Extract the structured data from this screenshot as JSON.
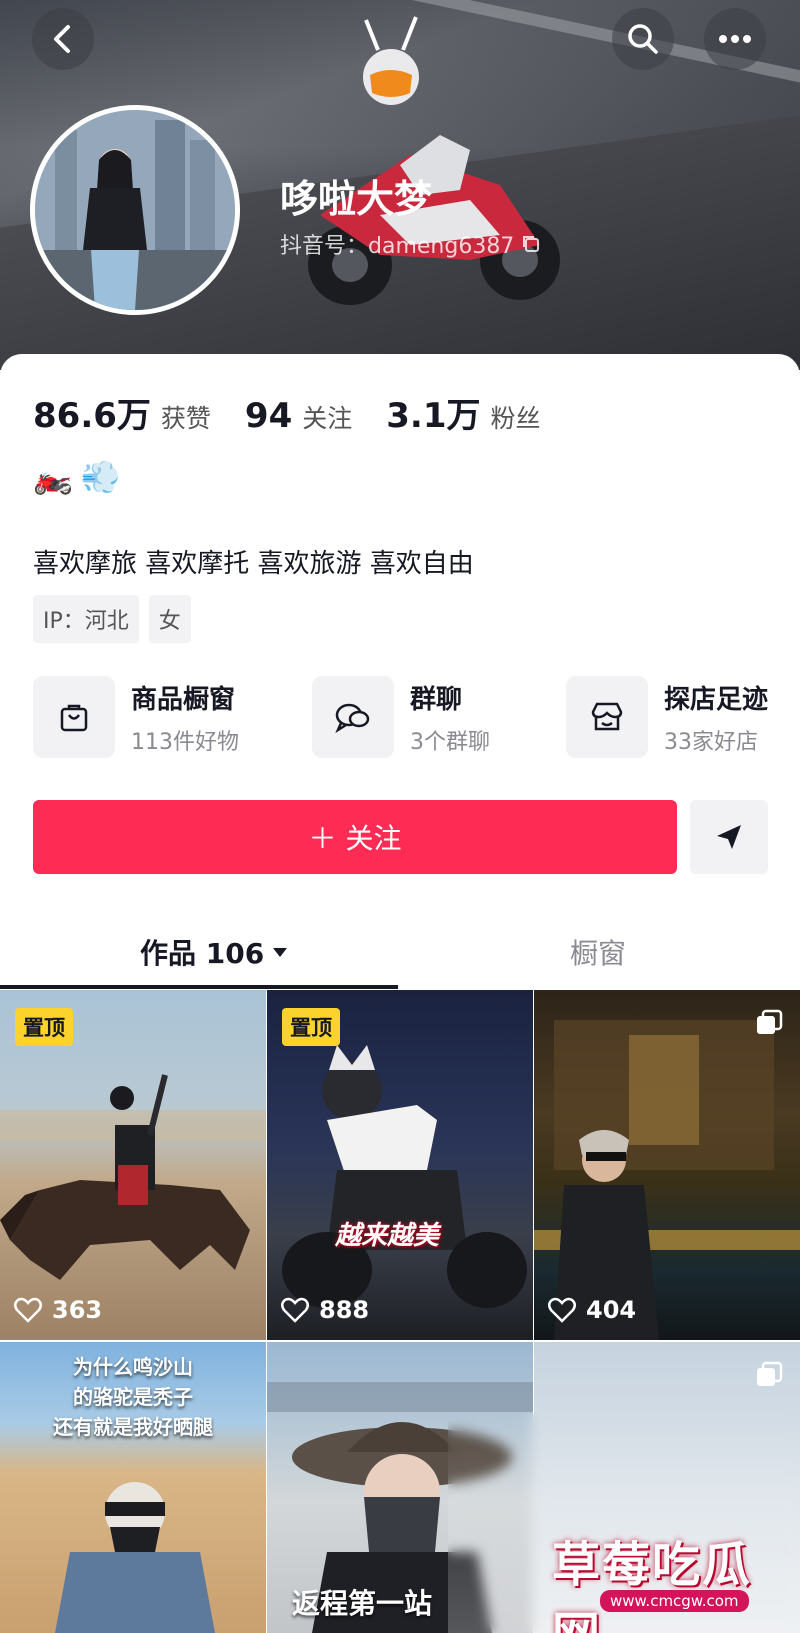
{
  "header": {
    "name": "哆啦大梦",
    "id_label": "抖音号：dameng6387"
  },
  "stats": [
    {
      "value": "86.6万",
      "label": "获赞"
    },
    {
      "value": "94",
      "label": "关注"
    },
    {
      "value": "3.1万",
      "label": "粉丝"
    }
  ],
  "emojis": [
    "🏍️",
    "💨"
  ],
  "bio": "喜欢摩旅 喜欢摩托 喜欢旅游 喜欢自由",
  "tags": [
    "IP：河北",
    "女"
  ],
  "shortcuts": [
    {
      "title": "商品橱窗",
      "sub": "113件好物",
      "icon": "shopping-bag-icon"
    },
    {
      "title": "群聊",
      "sub": "3个群聊",
      "icon": "chat-bubbles-icon"
    },
    {
      "title": "探店足迹",
      "sub": "33家好店",
      "icon": "store-icon"
    }
  ],
  "actions": {
    "follow_label": "＋ 关注"
  },
  "tabs": {
    "works_label": "作品 106",
    "shop_label": "橱窗"
  },
  "videos": [
    {
      "pinned": "置顶",
      "likes": "363"
    },
    {
      "pinned": "置顶",
      "likes": "888",
      "overlay": "越来越美"
    },
    {
      "likes": "404"
    },
    {
      "overlay": "为什么鸣沙山\n的骆驼是秃子\n还有就是我好晒腿"
    },
    {
      "overlay": "返程第一站"
    },
    {}
  ],
  "watermark": {
    "text": "草莓吃瓜网",
    "url": "www.cmcgw.com"
  },
  "colors": {
    "accent": "#fe2c55",
    "pin": "#fbd32c"
  }
}
